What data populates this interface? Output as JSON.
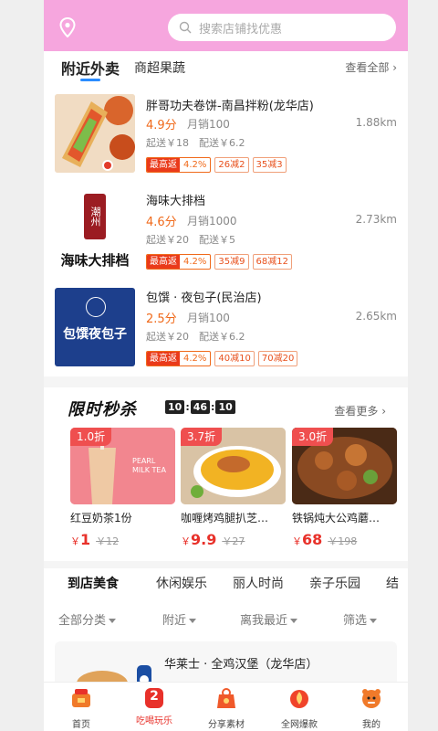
{
  "search": {
    "placeholder": "搜索店铺找优惠"
  },
  "tabs": {
    "nearby": "附近外卖",
    "market": "商超果蔬",
    "view_all": "查看全部 ›"
  },
  "shops": [
    {
      "name": "胖哥功夫卷饼-南昌拌粉(龙华店)",
      "score": "4.9分",
      "sales": "月销100",
      "distance": "1.88km",
      "delivery": "起送￥18　配送￥6.2",
      "rebate_label": "最高返",
      "rebate": "4.2%",
      "deals": [
        "26减2",
        "35减3"
      ]
    },
    {
      "name": "海味大排档",
      "score": "4.6分",
      "sales": "月销1000",
      "distance": "2.73km",
      "delivery": "起送￥20　配送￥5",
      "rebate_label": "最高返",
      "rebate": "4.2%",
      "deals": [
        "35减9",
        "68减12"
      ],
      "logo_text": "海味大排档",
      "logo_seal": "潮州"
    },
    {
      "name": "包馔 · 夜包子(民治店)",
      "score": "2.5分",
      "sales": "月销100",
      "distance": "2.65km",
      "delivery": "起送￥20　配送￥6.2",
      "rebate_label": "最高返",
      "rebate": "4.2%",
      "deals": [
        "40减10",
        "70减20"
      ],
      "logo_text": "包馔夜包子"
    }
  ],
  "flash": {
    "title": "限时秒杀",
    "timer": [
      "10",
      "46",
      "10"
    ],
    "more": "查看更多 ›",
    "items": [
      {
        "discount": "1.0折",
        "name": "红豆奶茶1份",
        "currency": "￥",
        "price": "1",
        "orig": "￥12",
        "img_text": "PEARL MILK TEA"
      },
      {
        "discount": "3.7折",
        "name": "咖喱烤鸡腿扒芝…",
        "currency": "￥",
        "price": "9.9",
        "orig": "￥27"
      },
      {
        "discount": "3.0折",
        "name": "铁锅炖大公鸡蘑…",
        "currency": "￥",
        "price": "68",
        "orig": "￥198"
      }
    ]
  },
  "categories": [
    "到店美食",
    "休闲娱乐",
    "丽人时尚",
    "亲子乐园",
    "结"
  ],
  "filters": [
    "全部分类",
    "附近",
    "离我最近",
    "筛选"
  ],
  "card": {
    "name": "华莱士 · 全鸡汉堡（龙华店）"
  },
  "nav": [
    "首页",
    "吃喝玩乐",
    "分享素材",
    "全网爆款",
    "我的"
  ],
  "nav_badge": "2",
  "colors": {
    "header": "#f6a6de",
    "accent": "#e8312a",
    "score": "#f06a1b",
    "tab_underline": "#2a8cff"
  }
}
